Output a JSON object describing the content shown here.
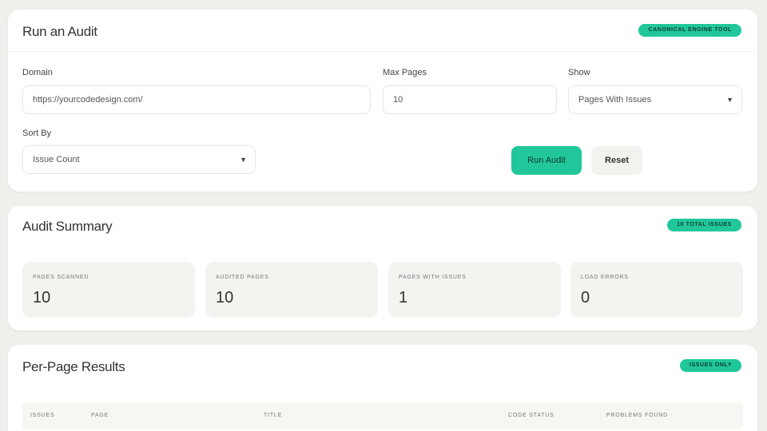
{
  "audit": {
    "title": "Run an Audit",
    "badge": "Canonical Engine Tool",
    "domain_label": "Domain",
    "domain_value": "https://yourcodedesign.com/",
    "max_pages_label": "Max Pages",
    "max_pages_value": "10",
    "show_label": "Show",
    "show_value": "Pages With Issues",
    "sort_label": "Sort By",
    "sort_value": "Issue Count",
    "run_label": "Run Audit",
    "reset_label": "Reset"
  },
  "summary": {
    "title": "Audit Summary",
    "badge": "10 Total Issues",
    "stats": [
      {
        "label": "Pages Scanned",
        "value": "10"
      },
      {
        "label": "Audited Pages",
        "value": "10"
      },
      {
        "label": "Pages With Issues",
        "value": "1"
      },
      {
        "label": "Load Errors",
        "value": "0"
      }
    ]
  },
  "results": {
    "title": "Per-Page Results",
    "badge": "Issues Only",
    "columns": [
      "Issues",
      "Page",
      "Title",
      "Code Status",
      "Problems Found"
    ]
  },
  "colors": {
    "accent": "#21c79a",
    "background": "#efefec",
    "card": "#ffffff"
  },
  "icons": {
    "select_arrow": "chevron-down-icon"
  }
}
